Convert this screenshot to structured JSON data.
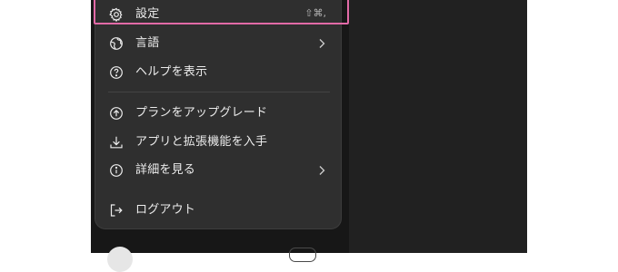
{
  "menu": {
    "items": [
      {
        "label": "設定",
        "icon": "gear-icon",
        "shortcut": "⇧⌘,"
      },
      {
        "label": "言語",
        "icon": "globe-icon",
        "submenu": true
      },
      {
        "label": "ヘルプを表示",
        "icon": "help-icon"
      },
      {
        "label": "プランをアップグレード",
        "icon": "upgrade-icon"
      },
      {
        "label": "アプリと拡張機能を入手",
        "icon": "download-icon"
      },
      {
        "label": "詳細を見る",
        "icon": "info-icon",
        "submenu": true
      },
      {
        "label": "ログアウト",
        "icon": "logout-icon"
      }
    ]
  },
  "colors": {
    "menu_bg": "#2f2f2f",
    "text": "#ececec",
    "highlight": "#e26aa7",
    "app_bg": "#212121"
  }
}
